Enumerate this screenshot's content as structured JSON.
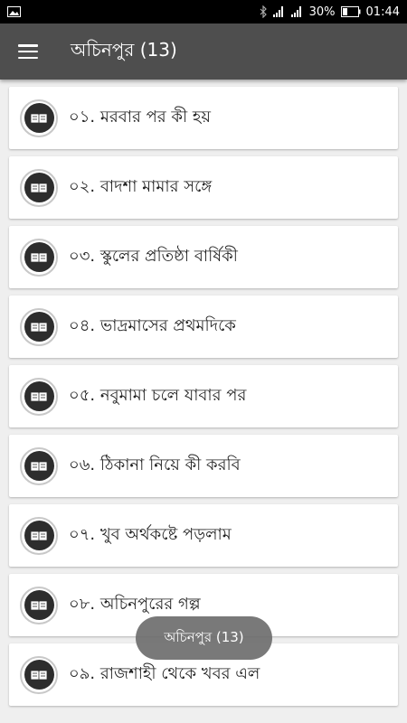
{
  "status_bar": {
    "battery_percent": "30%",
    "time": "01:44",
    "icons": [
      "image-icon",
      "bluetooth-icon",
      "signal-icon",
      "signal-icon",
      "battery-icon"
    ]
  },
  "app_bar": {
    "title": "অচিনপুর (13)",
    "menu_icon": "hamburger-menu-icon"
  },
  "items": [
    {
      "label": "০১. মরবার পর কী হয়"
    },
    {
      "label": "০২. বাদশা মামার সঙ্গে"
    },
    {
      "label": "০৩. স্কুলের প্রতিষ্ঠা বার্ষিকী"
    },
    {
      "label": "০৪. ভাদ্রমাসের প্রথমদিকে"
    },
    {
      "label": "০৫. নবুমামা চলে যাবার পর"
    },
    {
      "label": "০৬. ঠিকানা নিয়ে কী করবি"
    },
    {
      "label": "০৭. খুব অর্থকষ্টে পড়লাম"
    },
    {
      "label": "০৮. অচিনপুরের গল্প"
    },
    {
      "label": "০৯. রাজশাহী থেকে খবর এল"
    }
  ],
  "toast": {
    "text": "অচিনপুর (13)"
  },
  "colors": {
    "app_bar": "#4e4e4e",
    "background": "#efefef",
    "card": "#ffffff",
    "icon_dark": "#2d2d2d"
  }
}
